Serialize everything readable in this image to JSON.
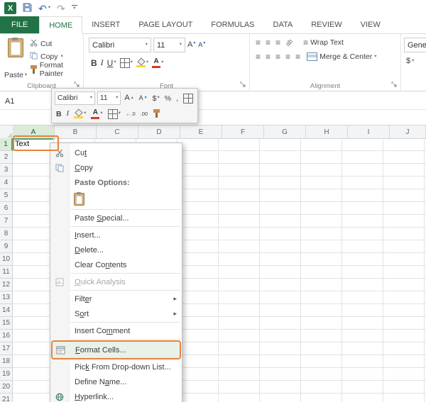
{
  "qat": {
    "logo_letter": "X"
  },
  "tabs": {
    "file": "FILE",
    "home": "HOME",
    "insert": "INSERT",
    "page_layout": "PAGE LAYOUT",
    "formulas": "FORMULAS",
    "data": "DATA",
    "review": "REVIEW",
    "view": "VIEW"
  },
  "ribbon": {
    "clipboard": {
      "group_label": "Clipboard",
      "paste": "Paste",
      "cut": "Cut",
      "copy": "Copy",
      "format_painter": "Format Painter"
    },
    "font": {
      "group_label": "Font",
      "font_name": "Calibri",
      "font_size": "11",
      "bold": "B",
      "italic": "I",
      "underline": "U",
      "grow": "A",
      "shrink": "A",
      "color_letter": "A"
    },
    "alignment": {
      "group_label": "Alignment",
      "wrap_text": "Wrap Text",
      "merge_center": "Merge & Center"
    },
    "number": {
      "format_partial": "Gener",
      "currency": "$"
    }
  },
  "formula_bar": {
    "name_box": "A1"
  },
  "mini_toolbar": {
    "font_name": "Calibri",
    "font_size": "11",
    "grow": "A",
    "shrink": "A",
    "currency": "$",
    "percent": "%",
    "comma": ",",
    "bold": "B",
    "italic": "I",
    "color_letter": "A",
    "inc_decimal": "←.0",
    "dec_decimal": ".00"
  },
  "sheet": {
    "selected_cell": "A1",
    "columns": [
      "A",
      "B",
      "C",
      "D",
      "E",
      "F",
      "G",
      "H",
      "I",
      "J"
    ],
    "rows": [
      "1",
      "2",
      "3",
      "4",
      "5",
      "6",
      "7",
      "8",
      "9",
      "10",
      "11",
      "12",
      "13",
      "14",
      "15",
      "16",
      "17",
      "18",
      "19",
      "20",
      "21"
    ],
    "cells": {
      "A1": "Text"
    }
  },
  "context_menu": {
    "items": [
      {
        "label": "Cut",
        "u": 2
      },
      {
        "label": "Copy",
        "u": 0
      },
      {
        "label": "Paste Options:",
        "u": -1
      },
      {
        "label": "Paste Special...",
        "u": 6
      },
      {
        "label": "Insert...",
        "u": 0
      },
      {
        "label": "Delete...",
        "u": 0
      },
      {
        "label": "Clear Contents",
        "u": 8
      },
      {
        "label": "Quick Analysis",
        "u": 0
      },
      {
        "label": "Filter",
        "u": 4
      },
      {
        "label": "Sort",
        "u": 1
      },
      {
        "label": "Insert Comment",
        "u": 9
      },
      {
        "label": "Format Cells...",
        "u": 0
      },
      {
        "label": "Pick From Drop-down List...",
        "u": 3
      },
      {
        "label": "Define Name...",
        "u": 8
      },
      {
        "label": "Hyperlink...",
        "u": 0
      }
    ]
  },
  "icons": {
    "dropdown": "▾",
    "submenu": "▸",
    "undo": "↶",
    "redo": "↷",
    "bars": "≡",
    "up": "▲",
    "down": "▼",
    "orientation": "ab"
  },
  "colors": {
    "excel_green": "#217346",
    "annotation_orange": "#e8823b"
  }
}
